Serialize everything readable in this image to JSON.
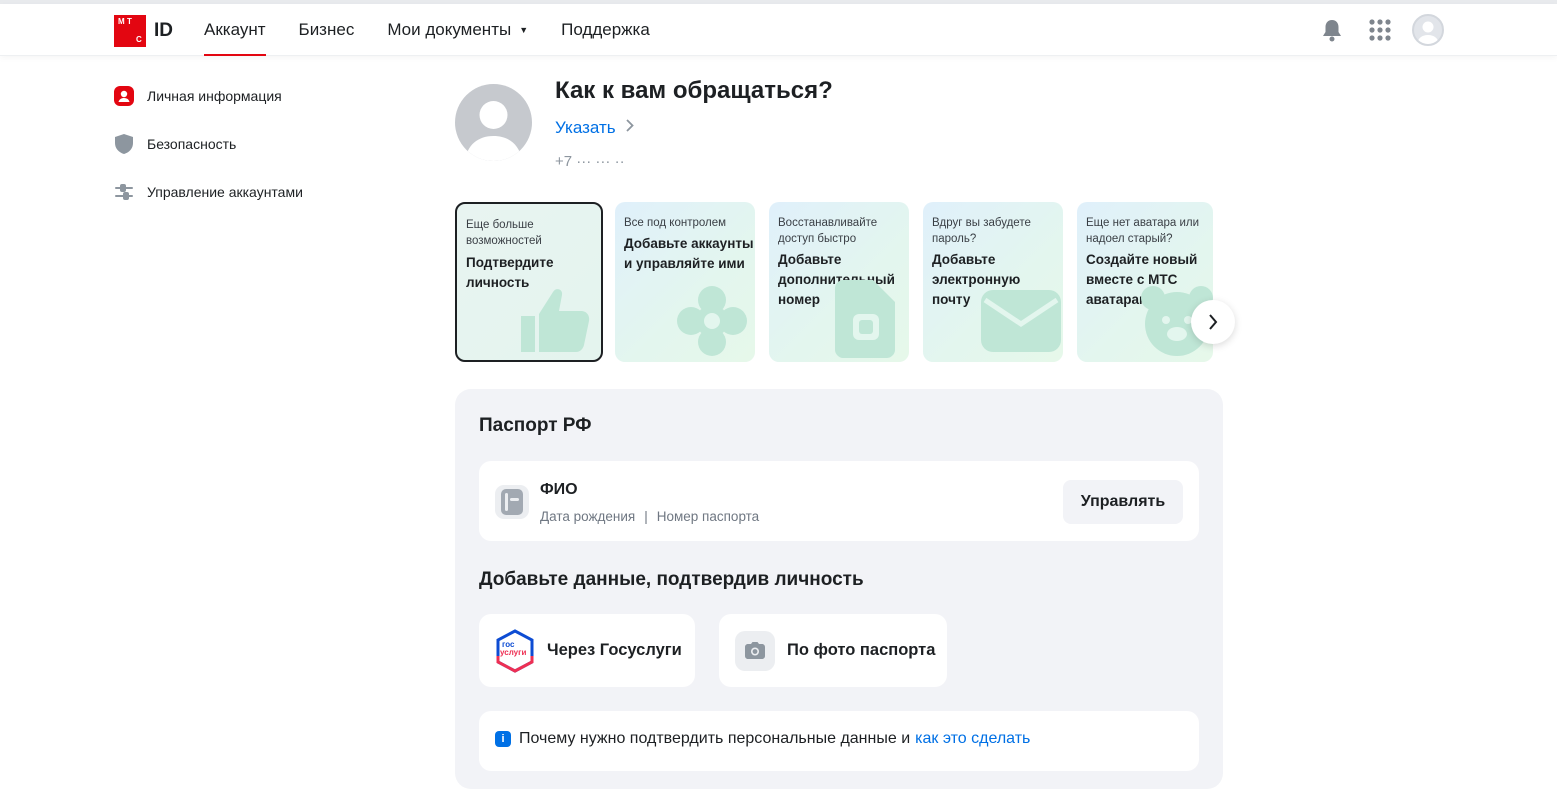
{
  "header": {
    "logo_letters": [
      "М",
      "Т",
      "С"
    ],
    "logo_id": "ID",
    "nav": [
      {
        "label": "Аккаунт",
        "active": true
      },
      {
        "label": "Бизнес"
      },
      {
        "label": "Мои документы",
        "has_dropdown": true
      },
      {
        "label": "Поддержка"
      }
    ],
    "icons": [
      "bell-icon",
      "apps-grid-icon",
      "avatar"
    ]
  },
  "sidebar": {
    "items": [
      {
        "label": "Личная информация",
        "icon": "person-icon",
        "active": true
      },
      {
        "label": "Безопасность",
        "icon": "shield-icon"
      },
      {
        "label": "Управление аккаунтами",
        "icon": "sliders-icon"
      }
    ]
  },
  "profile": {
    "greeting": "Как к вам обращаться?",
    "specify_link": "Указать",
    "phone": "+7 ··· ··· ··"
  },
  "cards": [
    {
      "small": "Еще больше возможностей",
      "big": "Подтвердите личность",
      "icon": "thumbs-up-icon"
    },
    {
      "small": "Все под контролем",
      "big": "Добавьте аккаунты и управляйте ими",
      "icon": "flower-icon"
    },
    {
      "small": "Восстанавливайте доступ быстро",
      "big": "Добавьте дополнительный номер",
      "icon": "sim-card-icon"
    },
    {
      "small": "Вдруг вы забудете пароль?",
      "big": "Добавьте электронную почту",
      "icon": "envelope-icon"
    },
    {
      "small": "Еще нет аватара или надоел старый?",
      "big": "Создайте новый вместе с МТС аватарами",
      "icon": "bear-icon"
    }
  ],
  "passport": {
    "title": "Паспорт РФ",
    "fio": {
      "title": "ФИО",
      "birth_date": "Дата рождения",
      "separator": "|",
      "passport_number": "Номер паспорта",
      "manage_button": "Управлять"
    },
    "add_title": "Добавьте данные, подтвердив личность",
    "options": [
      {
        "label": "Через Госуслуги",
        "icon": "gosuslugi-icon",
        "icon_text": [
          "гос",
          "услуги"
        ]
      },
      {
        "label": "По фото паспорта",
        "icon": "camera-icon"
      }
    ],
    "info": {
      "text": "Почему нужно подтвердить персональные данные и",
      "link": "как это сделать"
    }
  },
  "colors": {
    "brand_red": "#e30611",
    "link_blue": "#0070e5",
    "panel_bg": "#f2f3f7",
    "text": "#1d2023",
    "muted": "#8d969f"
  }
}
